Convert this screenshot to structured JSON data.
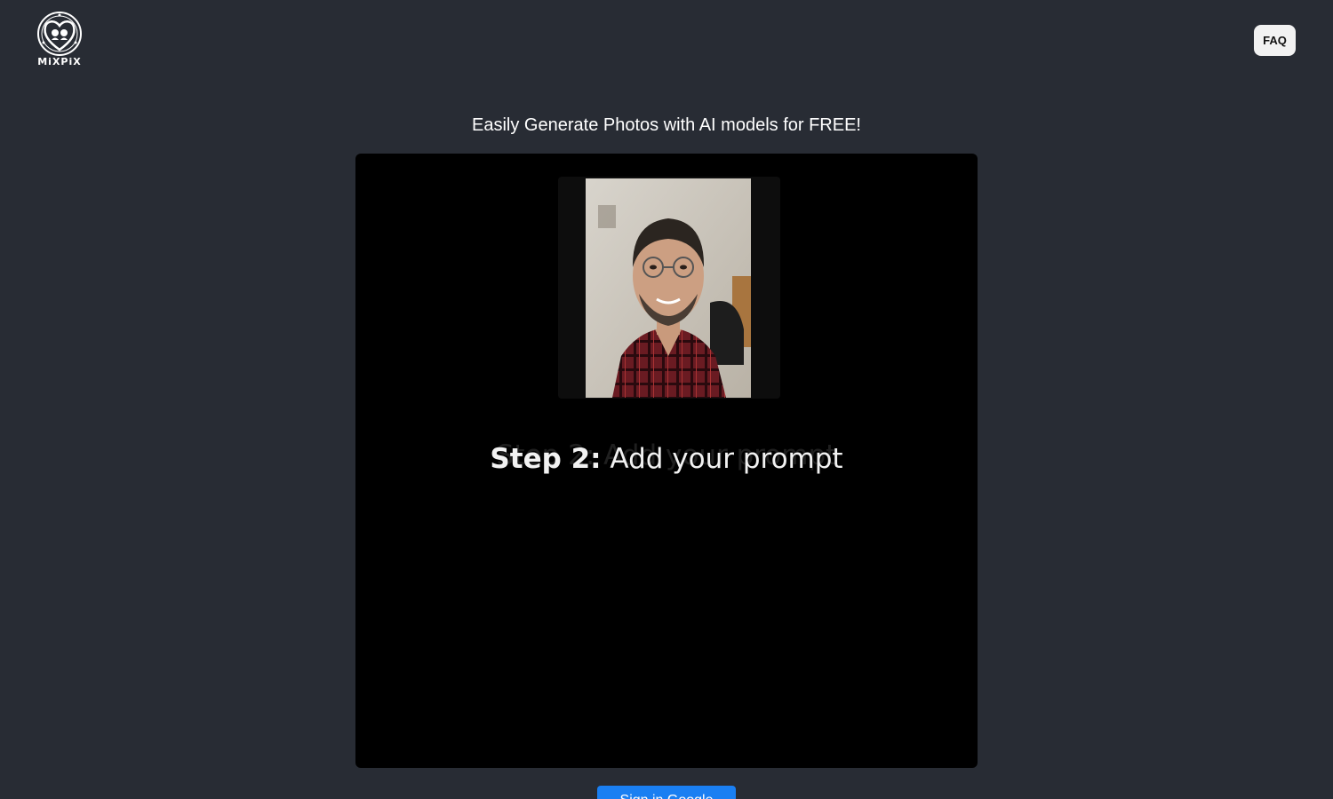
{
  "header": {
    "logo_text": "MiXPiX",
    "faq_label": "FAQ"
  },
  "main": {
    "headline": "Easily Generate Photos with AI models for FREE!",
    "video": {
      "caption_step": "Step 2:",
      "caption_text": " Add your prompt"
    },
    "signin_label": "Sign in Google"
  },
  "colors": {
    "background": "#282c34",
    "accent": "#1a7ff2",
    "faq_button": "#f2f2f2",
    "video_background": "#000000"
  }
}
